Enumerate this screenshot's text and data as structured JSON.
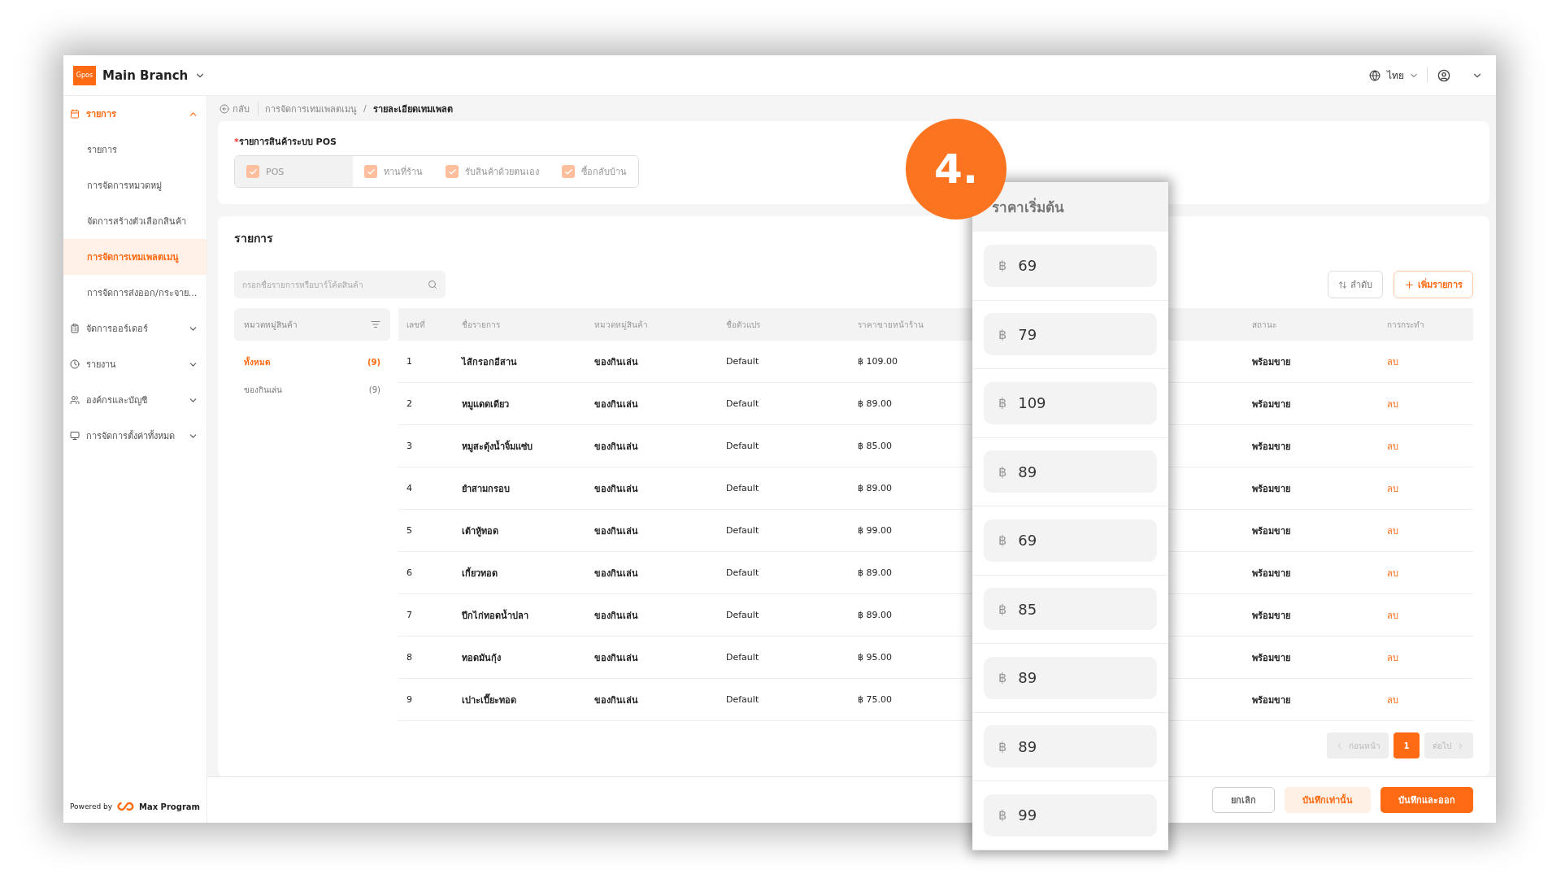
{
  "header": {
    "logo_text": "Gpos",
    "branch": "Main Branch",
    "language": "ไทย"
  },
  "sidebar": {
    "sections": [
      {
        "label": "รายการ",
        "selected": true,
        "expanded": true,
        "children": [
          {
            "label": "รายการ",
            "selected": false
          },
          {
            "label": "การจัดการหมวดหมู่",
            "selected": false
          },
          {
            "label": "จัดการสร้างตัวเลือกสินค้า",
            "selected": false
          },
          {
            "label": "การจัดการเทมเพลตเมนู",
            "selected": true
          },
          {
            "label": "การจัดการส่งออก/กระจาย...",
            "selected": false
          }
        ]
      },
      {
        "label": "จัดการออร์เดอร์",
        "selected": false,
        "expanded": false
      },
      {
        "label": "รายงาน",
        "selected": false,
        "expanded": false
      },
      {
        "label": "องค์กรและบัญชี",
        "selected": false,
        "expanded": false
      },
      {
        "label": "การจัดการตั้งค่าทั้งหมด",
        "selected": false,
        "expanded": false
      }
    ],
    "powered_by": "Powered by",
    "brand": "Max Program"
  },
  "breadcrumb": {
    "back": "กลับ",
    "separator": "/",
    "items": [
      "การจัดการเทมเพลตเมนู",
      "รายละเอียดเทมเพลต"
    ]
  },
  "pos_section": {
    "required_mark": "*",
    "label": "รายการสินค้าระบบ POS",
    "disabled": true,
    "options": [
      {
        "label": "POS",
        "checked": true,
        "selected": true
      },
      {
        "label": "ทานที่ร้าน",
        "checked": true,
        "selected": false
      },
      {
        "label": "รับสินค้าด้วยตนเอง",
        "checked": true,
        "selected": false
      },
      {
        "label": "ซื้อกลับบ้าน",
        "checked": true,
        "selected": false
      }
    ]
  },
  "list": {
    "title": "รายการ",
    "search": {
      "placeholder": "กรอกชื่อรายการหรือบาร์โค้ดสินค้า"
    },
    "sort_button": "ลำดับ",
    "add_button": "เพิ่มรายการ",
    "categories": {
      "header": "หมวดหมู่สินค้า",
      "items": [
        {
          "label": "ทั้งหมด",
          "count": "(9)",
          "selected": true
        },
        {
          "label": "ของกินเล่น",
          "count": "(9)",
          "selected": false
        }
      ]
    },
    "table": {
      "columns": [
        "เลขที่",
        "ชื่อรายการ",
        "หมวดหมู่สินค้า",
        "ชื่อตัวแปร",
        "ราคาขายหน้าร้าน",
        "สถานะ",
        "การกระทำ"
      ],
      "rows": [
        {
          "number": "1",
          "name": "ไส้กรอกอีสาน",
          "category": "ของกินเล่น",
          "variant": "Default",
          "price": "฿ 109.00",
          "status": "พร้อมขาย",
          "action": "ลบ"
        },
        {
          "number": "2",
          "name": "หมูแดดเดียว",
          "category": "ของกินเล่น",
          "variant": "Default",
          "price": "฿ 89.00",
          "status": "พร้อมขาย",
          "action": "ลบ"
        },
        {
          "number": "3",
          "name": "หมูสะดุ้งน้ำจิ้มแซ่บ",
          "category": "ของกินเล่น",
          "variant": "Default",
          "price": "฿ 85.00",
          "status": "พร้อมขาย",
          "action": "ลบ"
        },
        {
          "number": "4",
          "name": "ยำสามกรอบ",
          "category": "ของกินเล่น",
          "variant": "Default",
          "price": "฿ 89.00",
          "status": "พร้อมขาย",
          "action": "ลบ"
        },
        {
          "number": "5",
          "name": "เต้าหู้ทอด",
          "category": "ของกินเล่น",
          "variant": "Default",
          "price": "฿ 99.00",
          "status": "พร้อมขาย",
          "action": "ลบ"
        },
        {
          "number": "6",
          "name": "เกี้ยวทอด",
          "category": "ของกินเล่น",
          "variant": "Default",
          "price": "฿ 89.00",
          "status": "พร้อมขาย",
          "action": "ลบ"
        },
        {
          "number": "7",
          "name": "ปีกไก่ทอดน้ำปลา",
          "category": "ของกินเล่น",
          "variant": "Default",
          "price": "฿ 89.00",
          "status": "พร้อมขาย",
          "action": "ลบ"
        },
        {
          "number": "8",
          "name": "ทอดมันกุ้ง",
          "category": "ของกินเล่น",
          "variant": "Default",
          "price": "฿ 95.00",
          "status": "พร้อมขาย",
          "action": "ลบ"
        },
        {
          "number": "9",
          "name": "เปาะเปี๊ยะทอด",
          "category": "ของกินเล่น",
          "variant": "Default",
          "price": "฿ 75.00",
          "status": "พร้อมขาย",
          "action": "ลบ"
        }
      ]
    },
    "pagination": {
      "prev": {
        "label": "ก่อนหน้า",
        "disabled": true
      },
      "pages": [
        {
          "label": "1",
          "selected": true
        }
      ],
      "next": {
        "label": "ต่อไป",
        "disabled": true
      }
    }
  },
  "footer_buttons": [
    {
      "label": "ยกเลิก",
      "kind": "outline"
    },
    {
      "label": "บันทึกเท่านั้น",
      "kind": "soft"
    },
    {
      "label": "บันทึกและออก",
      "kind": "primary"
    }
  ],
  "callout": {
    "step": "4.",
    "title": "ราคาเริ่มต้น",
    "prices": [
      {
        "currency": "฿",
        "value": "69"
      },
      {
        "currency": "฿",
        "value": "79"
      },
      {
        "currency": "฿",
        "value": "109"
      },
      {
        "currency": "฿",
        "value": "89"
      },
      {
        "currency": "฿",
        "value": "69"
      },
      {
        "currency": "฿",
        "value": "85"
      },
      {
        "currency": "฿",
        "value": "89"
      },
      {
        "currency": "฿",
        "value": "89"
      },
      {
        "currency": "฿",
        "value": "99"
      }
    ]
  }
}
